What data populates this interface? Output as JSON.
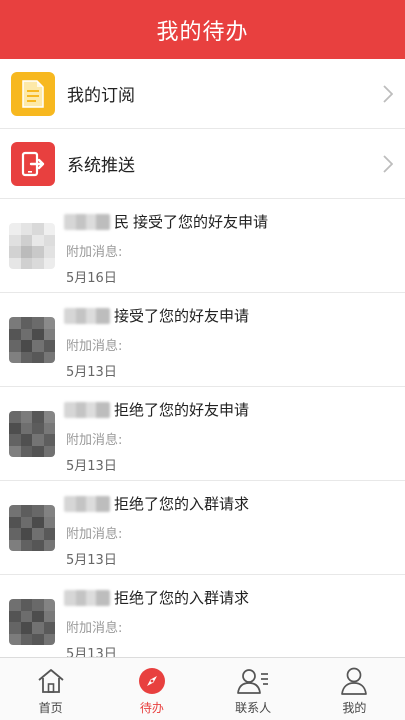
{
  "header": {
    "title": "我的待办"
  },
  "entries": [
    {
      "label": "我的订阅",
      "icon": "document-list-icon",
      "color": "#f7b81f"
    },
    {
      "label": "系统推送",
      "icon": "phone-exit-icon",
      "color": "#e8403f"
    }
  ],
  "messages": [
    {
      "sender_suffix": "民",
      "action": "接受了您的好友申请",
      "extra_label": "附加消息:",
      "date": "5月16日"
    },
    {
      "sender_suffix": "",
      "action": "接受了您的好友申请",
      "extra_label": "附加消息:",
      "date": "5月13日"
    },
    {
      "sender_suffix": "",
      "action": "拒绝了您的好友申请",
      "extra_label": "附加消息:",
      "date": "5月13日"
    },
    {
      "sender_suffix": "",
      "action": "拒绝了您的入群请求",
      "extra_label": "附加消息:",
      "date": "5月13日"
    },
    {
      "sender_suffix": "",
      "action": "拒绝了您的入群请求",
      "extra_label": "附加消息:",
      "date": "5月13日"
    }
  ],
  "tabs": [
    {
      "label": "首页",
      "icon": "home-icon",
      "active": false
    },
    {
      "label": "待办",
      "icon": "compass-icon",
      "active": true
    },
    {
      "label": "联系人",
      "icon": "contacts-icon",
      "active": false
    },
    {
      "label": "我的",
      "icon": "person-icon",
      "active": false
    }
  ],
  "colors": {
    "brand": "#e8403f",
    "subscription": "#f7b81f"
  }
}
